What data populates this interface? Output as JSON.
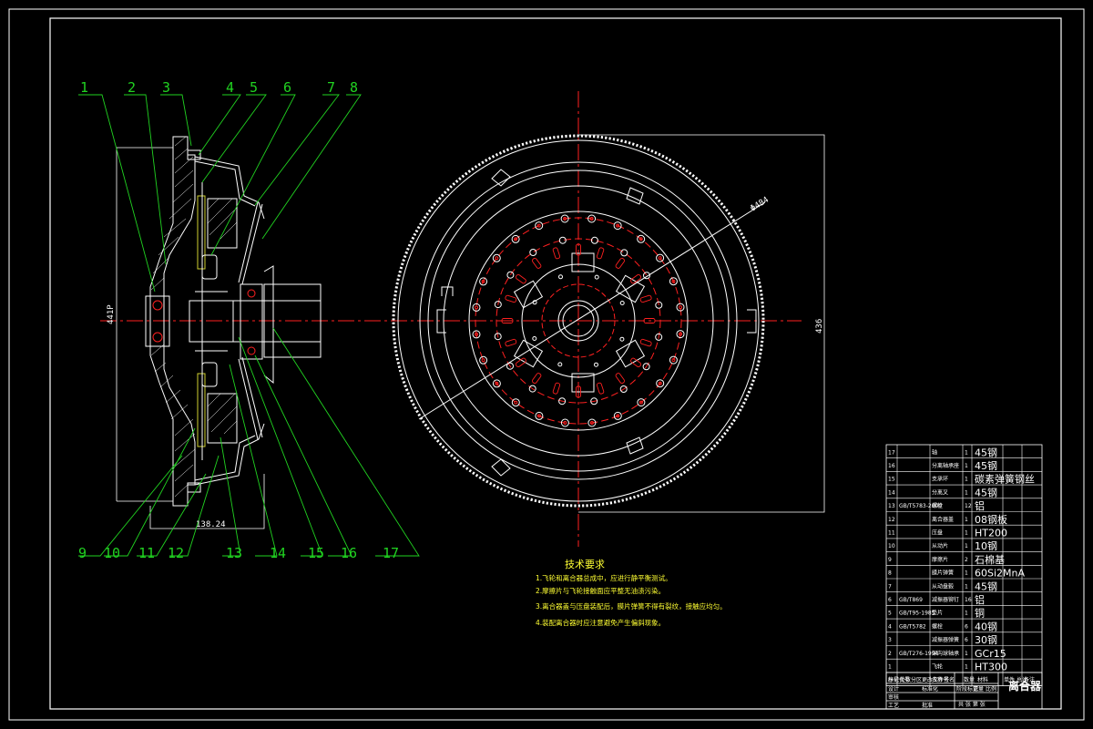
{
  "callouts": [
    "1",
    "2",
    "3",
    "4",
    "5",
    "6",
    "7",
    "8",
    "9",
    "10",
    "11",
    "12",
    "13",
    "14",
    "15",
    "16",
    "17"
  ],
  "dimensions": {
    "height_left": "441P",
    "width_bottom": "138.24",
    "diameter": "Φ484",
    "height_right": "436"
  },
  "notes": {
    "title": "技术要求",
    "items": [
      "1.飞轮和离合器总成中，应进行静平衡测试。",
      "2.摩擦片与飞轮接触面应平整无油渍污染。",
      "3.离合器盖与压盘装配后，膜片弹簧不得有裂纹，接触应均匀。",
      "4.装配离合器时应注意避免产生偏斜现象。"
    ]
  },
  "parts": [
    {
      "no": "17",
      "code": "",
      "name": "轴",
      "qty": "1",
      "mat": "45钢"
    },
    {
      "no": "16",
      "code": "",
      "name": "分离轴承座",
      "qty": "1",
      "mat": "45钢"
    },
    {
      "no": "15",
      "code": "",
      "name": "支承环",
      "qty": "1",
      "mat": "碳素弹簧钢丝"
    },
    {
      "no": "14",
      "code": "",
      "name": "分离叉",
      "qty": "1",
      "mat": "45钢"
    },
    {
      "no": "13",
      "code": "GB/T5783-2000",
      "name": "螺栓",
      "qty": "12",
      "mat": "铝"
    },
    {
      "no": "12",
      "code": "",
      "name": "离合器盖",
      "qty": "1",
      "mat": "08钢板"
    },
    {
      "no": "11",
      "code": "",
      "name": "压盘",
      "qty": "1",
      "mat": "HT200"
    },
    {
      "no": "10",
      "code": "",
      "name": "从动片",
      "qty": "1",
      "mat": "10钢"
    },
    {
      "no": "9",
      "code": "",
      "name": "摩擦片",
      "qty": "2",
      "mat": "石棉基"
    },
    {
      "no": "8",
      "code": "",
      "name": "膜片弹簧",
      "qty": "1",
      "mat": "60Si2MnA"
    },
    {
      "no": "7",
      "code": "",
      "name": "从动盘毂",
      "qty": "1",
      "mat": "45钢"
    },
    {
      "no": "6",
      "code": "GB/T869",
      "name": "减振器铆钉",
      "qty": "16",
      "mat": "铝"
    },
    {
      "no": "5",
      "code": "GB/T95-1985",
      "name": "垫片",
      "qty": "1",
      "mat": "铜"
    },
    {
      "no": "4",
      "code": "GB/T5782",
      "name": "螺栓",
      "qty": "6",
      "mat": "40钢"
    },
    {
      "no": "3",
      "code": "",
      "name": "减振器弹簧",
      "qty": "6",
      "mat": "30钢"
    },
    {
      "no": "2",
      "code": "GB/T276-1994",
      "name": "深沟球轴承",
      "qty": "1",
      "mat": "GCr15"
    },
    {
      "no": "1",
      "code": "",
      "name": "飞轮",
      "qty": "1",
      "mat": "HT300"
    }
  ],
  "table_header": {
    "no": "序号",
    "code": "代号",
    "name": "名称",
    "qty": "数量",
    "mat": "材料",
    "weight": "单件 总计",
    "remark": "备注"
  },
  "title_block": {
    "drawing_name": "离合器",
    "row1": [
      "标记",
      "处数",
      "分区",
      "更改文件号",
      "签名",
      "年月日"
    ],
    "row2": [
      "设计",
      "",
      "标准化",
      "",
      "阶段标记",
      "重量",
      "比例"
    ],
    "row3": [
      "审核",
      "",
      "",
      "",
      "共 张 第 张"
    ],
    "row4": [
      "工艺",
      "",
      "批准"
    ]
  },
  "colors": {
    "background": "#000000",
    "line": "#ffffff",
    "center": "#ff2020",
    "leader": "#21d321",
    "note": "#ffff33",
    "cross": "#6dff6d"
  }
}
